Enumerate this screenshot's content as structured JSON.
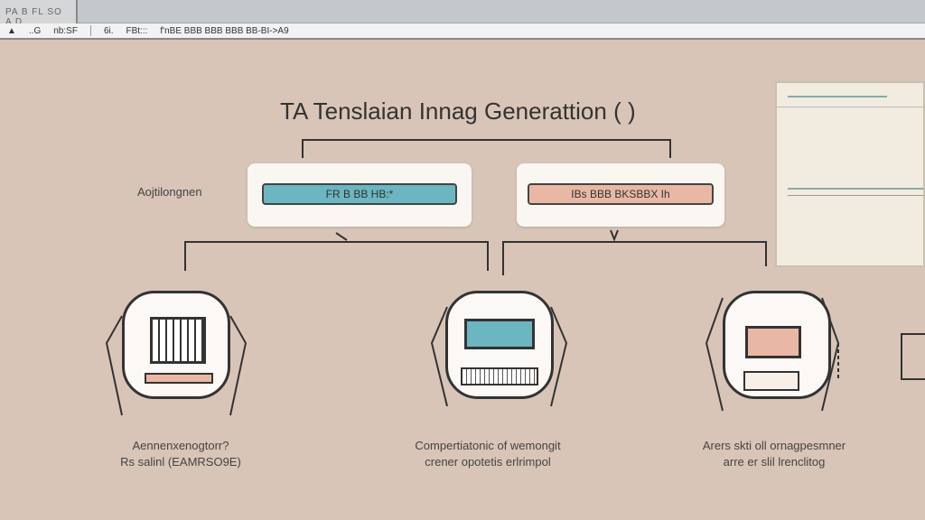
{
  "window": {
    "tab_title": "PA B FL SO A D"
  },
  "toolbar": {
    "items": [
      "..G",
      "nb:SF",
      "6i.",
      "FBt:::",
      "f'nBE BBB BBB BBB BB-BI->A9"
    ]
  },
  "main": {
    "title": "TA Tenslaian Innag Generattion ( )",
    "side_label": "Aojtilongnen",
    "box_left": "FR B BB HB:*",
    "box_right": "IBs BBB BKSBBX Ih",
    "captions": [
      {
        "line1": "Aennenxenogtorr?",
        "line2": "Rs salinl (EAMRSO9E)"
      },
      {
        "line1": "Compertiatonic of wemongit",
        "line2": "crener opotetis erlrimpol"
      },
      {
        "line1": "Arers skti oll ornagpesmner",
        "line2": "arre er slil lrenclitog"
      }
    ]
  },
  "colors": {
    "background": "#d8c5b8",
    "teal": "#6bb6c0",
    "salmon": "#e9b8a4"
  }
}
